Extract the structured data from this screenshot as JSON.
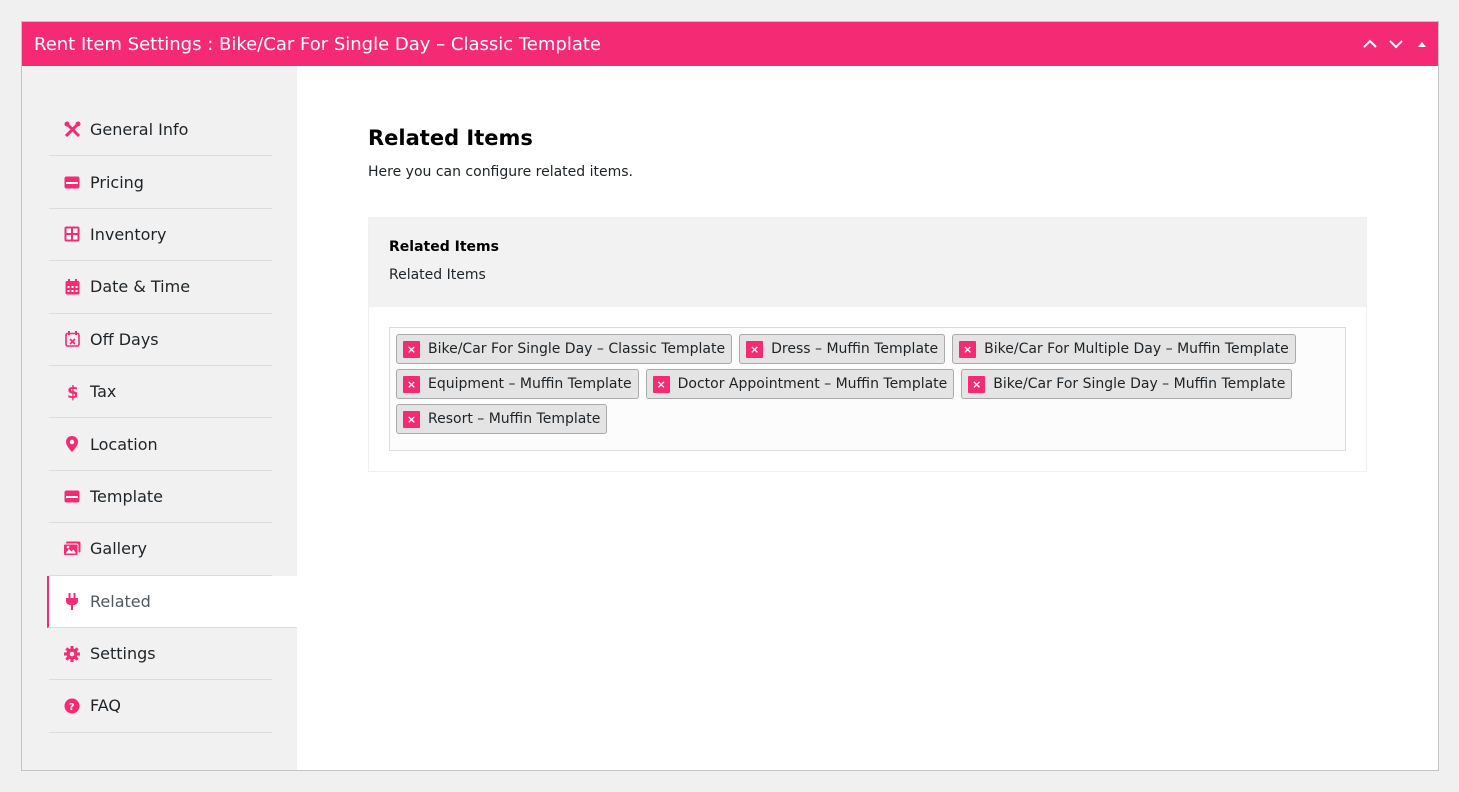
{
  "header": {
    "title": "Rent Item Settings : Bike/Car For Single Day – Classic Template",
    "controls": [
      "chevron-up-icon",
      "chevron-down-icon",
      "triangle-up-icon"
    ]
  },
  "colors": {
    "accent": "#f42b74",
    "sidebar_bg": "#f1f1f1",
    "page_bg": "#f0f0f1"
  },
  "sidebar": {
    "items": [
      {
        "label": "General Info",
        "icon": "tools-icon"
      },
      {
        "label": "Pricing",
        "icon": "credit-card-icon"
      },
      {
        "label": "Inventory",
        "icon": "grid-icon"
      },
      {
        "label": "Date & Time",
        "icon": "calendar-icon"
      },
      {
        "label": "Off Days",
        "icon": "calendar-x-icon"
      },
      {
        "label": "Tax",
        "icon": "dollar-icon"
      },
      {
        "label": "Location",
        "icon": "map-pin-icon"
      },
      {
        "label": "Template",
        "icon": "credit-card-icon"
      },
      {
        "label": "Gallery",
        "icon": "images-icon"
      },
      {
        "label": "Related",
        "icon": "plug-icon",
        "active": true
      },
      {
        "label": "Settings",
        "icon": "gear-icon"
      },
      {
        "label": "FAQ",
        "icon": "question-circle-icon"
      }
    ]
  },
  "main": {
    "title": "Related Items",
    "description": "Here you can configure related items.",
    "box": {
      "title": "Related Items",
      "subtitle": "Related Items",
      "remove_symbol": "×",
      "tags": [
        "Bike/Car For Single Day – Classic Template",
        "Dress – Muffin Template",
        "Bike/Car For Multiple Day – Muffin Template",
        "Equipment – Muffin Template",
        "Doctor Appointment – Muffin Template",
        "Bike/Car For Single Day – Muffin Template",
        "Resort – Muffin Template"
      ]
    }
  }
}
